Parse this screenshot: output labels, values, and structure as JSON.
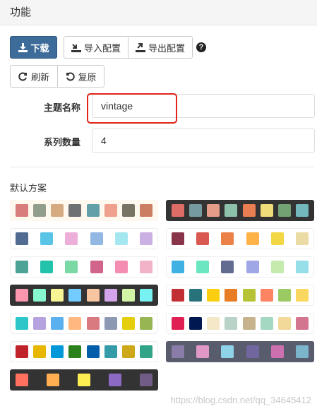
{
  "header": {
    "title": "功能"
  },
  "toolbar": {
    "download_label": "下载",
    "import_label": "导入配置",
    "export_label": "导出配置",
    "help_symbol": "?",
    "refresh_label": "刷新",
    "restore_label": "复原"
  },
  "form": {
    "theme_name_label": "主题名称",
    "theme_name_value": "vintage",
    "series_count_label": "系列数量",
    "series_count_value": "4"
  },
  "schemes": {
    "title": "默认方案",
    "items": [
      {
        "background": "#fef8ef",
        "colors": [
          "#d87c7c",
          "#919e8b",
          "#d7ab82",
          "#6e7074",
          "#61a0a8",
          "#efa18d",
          "#787464",
          "#cc7e63"
        ]
      },
      {
        "background": "#333333",
        "colors": [
          "#dd6b66",
          "#759aa0",
          "#e69d87",
          "#8dc1a9",
          "#ea7e53",
          "#eedd78",
          "#73a373",
          "#73b9bc"
        ]
      },
      {
        "background": "#ffffff",
        "colors": [
          "#516b91",
          "#59c4e6",
          "#edafda",
          "#93b7e3",
          "#a5e7f0",
          "#cbb0e3"
        ]
      },
      {
        "background": "#ffffff",
        "colors": [
          "#893448",
          "#d95850",
          "#eb8146",
          "#ffb248",
          "#f2d643",
          "#ebdba4"
        ]
      },
      {
        "background": "#ffffff",
        "colors": [
          "#4ea397",
          "#22c3aa",
          "#7bd9a5",
          "#d0648a",
          "#f58db2",
          "#f2b3c9"
        ]
      },
      {
        "background": "#ffffff",
        "colors": [
          "#3fb1e3",
          "#6be6c1",
          "#626c91",
          "#a0a7e6",
          "#c4ebad",
          "#96dee8"
        ]
      },
      {
        "background": "#333333",
        "colors": [
          "#fc97af",
          "#87f7cf",
          "#f7f494",
          "#72ccff",
          "#f7c5a0",
          "#d4a4eb",
          "#d2f5a6",
          "#76f2f2"
        ]
      },
      {
        "background": "#ffffff",
        "colors": [
          "#c12e34",
          "#27727b",
          "#fcce10",
          "#e87c25",
          "#b5c334",
          "#fe8463",
          "#9bca63",
          "#fad860"
        ]
      },
      {
        "background": "#ffffff",
        "colors": [
          "#2ec7c9",
          "#b6a2de",
          "#5ab1ef",
          "#ffb980",
          "#d87a80",
          "#8d98b3",
          "#e5cf0d",
          "#97b552"
        ]
      },
      {
        "background": "#ffffff",
        "colors": [
          "#e01f54",
          "#001852",
          "#f5e8c8",
          "#b8d2c7",
          "#c6b38e",
          "#a4d8c2",
          "#f3d999",
          "#d3758f"
        ]
      },
      {
        "background": "#ffffff",
        "colors": [
          "#c1232b",
          "#e6b600",
          "#0098d9",
          "#2b821d",
          "#005eaa",
          "#339ca8",
          "#cda819",
          "#32a487"
        ]
      },
      {
        "background": "#585c6c",
        "colors": [
          "#8a7ca8",
          "#e098c7",
          "#8fd3e8",
          "#71669e",
          "#cc70af",
          "#7cb4cc"
        ]
      },
      {
        "background": "#333333",
        "colors": [
          "#ff715e",
          "#ffaf51",
          "#ffee51",
          "#8c6ac4",
          "#715c87"
        ]
      }
    ]
  },
  "watermark": "https://blog.csdn.net/qq_34645412"
}
